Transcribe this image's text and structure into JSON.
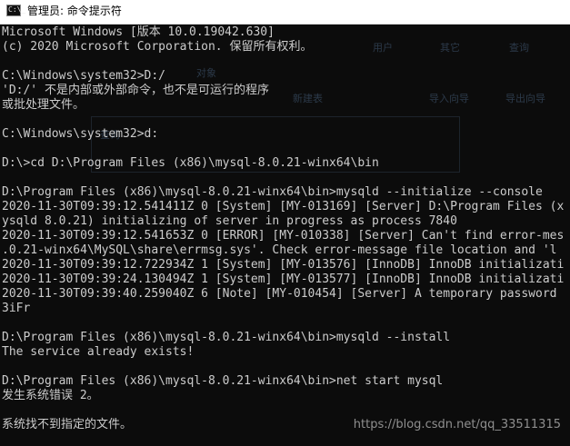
{
  "window": {
    "title": "管理员: 命令提示符",
    "icon": "cmd-console-icon",
    "icon_glyph": "C:\\_"
  },
  "background_ghost": {
    "labels": [
      "用户",
      "其它",
      "查询",
      "对象",
      "查询",
      "新建表",
      "导入向导",
      "导出向导"
    ]
  },
  "console": {
    "lines": [
      "Microsoft Windows [版本 10.0.19042.630]",
      "(c) 2020 Microsoft Corporation. 保留所有权利。",
      "",
      "C:\\Windows\\system32>D:/",
      "'D:/' 不是内部或外部命令，也不是可运行的程序",
      "或批处理文件。",
      "",
      "C:\\Windows\\system32>d:",
      "",
      "D:\\>cd D:\\Program Files (x86)\\mysql-8.0.21-winx64\\bin",
      "",
      "D:\\Program Files (x86)\\mysql-8.0.21-winx64\\bin>mysqld --initialize --console",
      "2020-11-30T09:39:12.541411Z 0 [System] [MY-013169] [Server] D:\\Program Files (x",
      "ysqld 8.0.21) initializing of server in progress as process 7840",
      "2020-11-30T09:39:12.541653Z 0 [ERROR] [MY-010338] [Server] Can't find error-mes",
      ".0.21-winx64\\MySQL\\share\\errmsg.sys'. Check error-message file location and 'l",
      "2020-11-30T09:39:12.722934Z 1 [System] [MY-013576] [InnoDB] InnoDB initializati",
      "2020-11-30T09:39:24.130494Z 1 [System] [MY-013577] [InnoDB] InnoDB initializati",
      "2020-11-30T09:39:40.259040Z 6 [Note] [MY-010454] [Server] A temporary password",
      "3iFr",
      "",
      "D:\\Program Files (x86)\\mysql-8.0.21-winx64\\bin>mysqld --install",
      "The service already exists!",
      "",
      "D:\\Program Files (x86)\\mysql-8.0.21-winx64\\bin>net start mysql",
      "发生系统错误 2。",
      "",
      "系统找不到指定的文件。"
    ]
  },
  "watermark": {
    "text": "https://blog.csdn.net/qq_33511315"
  },
  "colors": {
    "console_bg": "#0c0c0c",
    "console_fg": "#cccccc",
    "titlebar_bg": "#ffffff"
  }
}
